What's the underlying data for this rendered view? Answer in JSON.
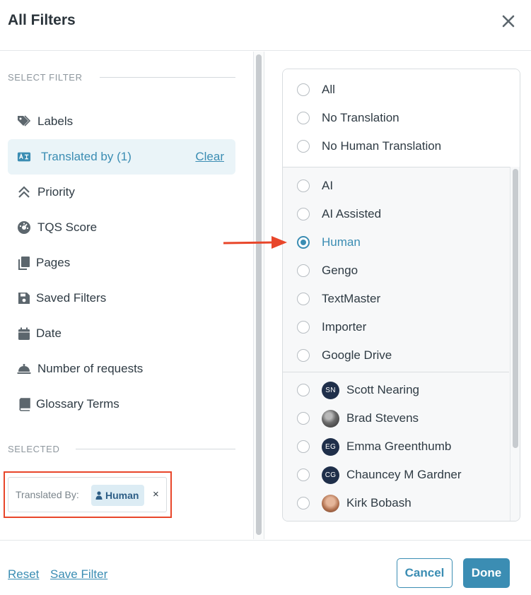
{
  "title": "All Filters",
  "left": {
    "select_filter_heading": "SELECT FILTER",
    "filters": [
      {
        "label": "Labels",
        "icon": "tag-icon"
      },
      {
        "label": "Translated by (1)",
        "icon": "translate-icon",
        "active": true,
        "clear": "Clear"
      },
      {
        "label": "Priority",
        "icon": "chevrons-up-icon"
      },
      {
        "label": "TQS Score",
        "icon": "gauge-icon"
      },
      {
        "label": "Pages",
        "icon": "pages-icon"
      },
      {
        "label": "Saved Filters",
        "icon": "save-icon"
      },
      {
        "label": "Date",
        "icon": "calendar-icon"
      },
      {
        "label": "Number of requests",
        "icon": "bell-icon"
      },
      {
        "label": "Glossary Terms",
        "icon": "book-icon"
      }
    ],
    "selected_heading": "SELECTED",
    "selected_chip": {
      "label": "Translated By:",
      "value": "Human",
      "remove": "×"
    }
  },
  "options": {
    "group1": [
      "All",
      "No Translation",
      "No Human Translation"
    ],
    "group2": [
      "AI",
      "AI Assisted",
      "Human",
      "Gengo",
      "TextMaster",
      "Importer",
      "Google Drive"
    ],
    "selected": "Human",
    "users": [
      {
        "name": "Scott Nearing",
        "initials": "SN"
      },
      {
        "name": "Brad Stevens",
        "initials": ""
      },
      {
        "name": "Emma Greenthumb",
        "initials": "EG"
      },
      {
        "name": "Chauncey M Gardner",
        "initials": "CG"
      },
      {
        "name": "Kirk Bobash",
        "initials": ""
      }
    ]
  },
  "footer": {
    "reset": "Reset",
    "save_filter": "Save Filter",
    "cancel": "Cancel",
    "done": "Done"
  },
  "colors": {
    "accent": "#3b8db3",
    "highlight_border": "#e8462a",
    "arrow": "#e8462a"
  }
}
